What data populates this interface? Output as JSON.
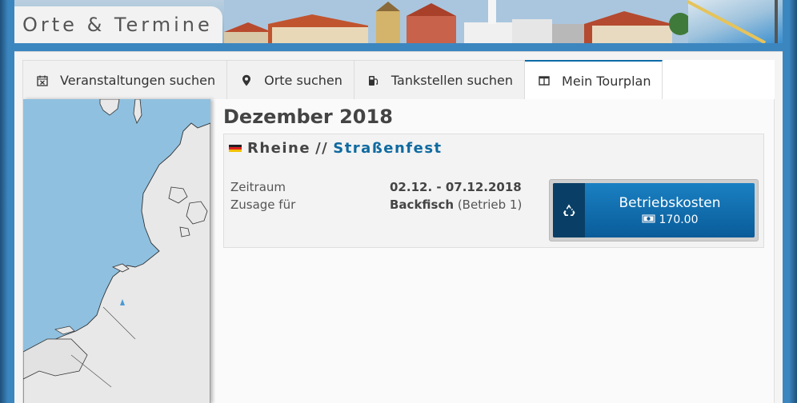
{
  "header": {
    "title": "Orte & Termine"
  },
  "tabs": [
    {
      "label": "Veranstaltungen suchen",
      "icon": "calendar-x-icon"
    },
    {
      "label": "Orte suchen",
      "icon": "map-marker-icon"
    },
    {
      "label": "Tankstellen suchen",
      "icon": "fuel-pump-icon"
    },
    {
      "label": "Mein Tourplan",
      "icon": "columns-icon",
      "active": true
    }
  ],
  "main": {
    "month": "Dezember 2018",
    "event": {
      "country_flag": "germany-flag-icon",
      "city": "Rheine",
      "separator": "//",
      "name": "Straßenfest",
      "details": {
        "zeitraum_label": "Zeitraum",
        "zeitraum_value": "02.12. - 07.12.2018",
        "zusage_label": "Zusage für",
        "zusage_value": "Backfisch",
        "zusage_sub": "(Betrieb 1)"
      },
      "cost_button": {
        "label": "Betriebskosten",
        "amount": "170.00",
        "icon": "recycle-icon",
        "amount_icon": "money-bill-icon"
      }
    }
  },
  "colors": {
    "accent": "#0d6aa8",
    "event_name": "#0f6aa0",
    "button_top": "#1a80c2",
    "button_bottom": "#0a5c99",
    "map_water": "#8fc0e0",
    "map_land": "#e8e8e8"
  }
}
